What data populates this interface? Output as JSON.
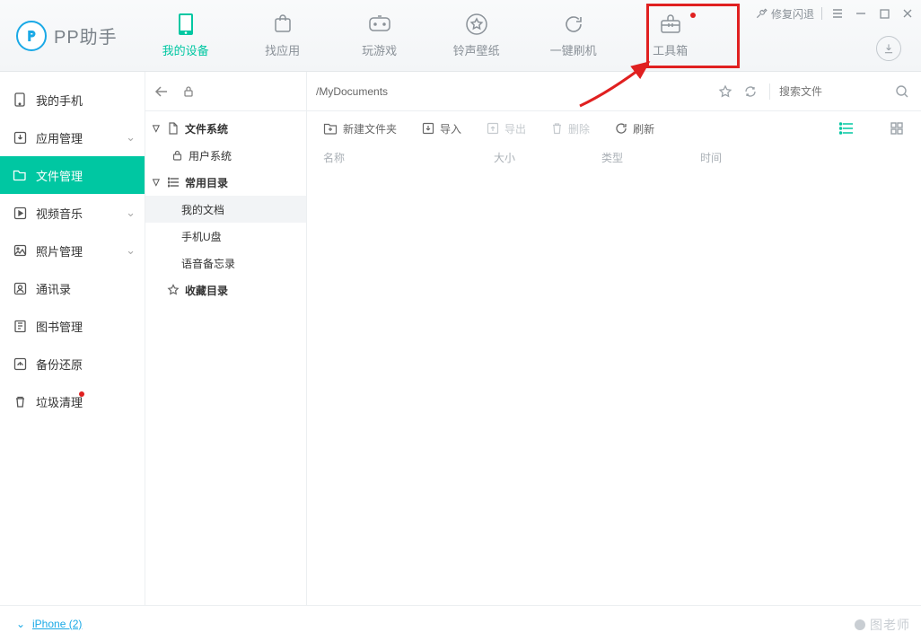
{
  "app": {
    "name": "PP助手"
  },
  "topnav": {
    "items": [
      {
        "label": "我的设备"
      },
      {
        "label": "找应用"
      },
      {
        "label": "玩游戏"
      },
      {
        "label": "铃声壁纸"
      },
      {
        "label": "一键刷机"
      },
      {
        "label": "工具箱"
      }
    ]
  },
  "topright": {
    "repair": "修复闪退"
  },
  "sidebar": {
    "items": [
      {
        "label": "我的手机"
      },
      {
        "label": "应用管理"
      },
      {
        "label": "文件管理"
      },
      {
        "label": "视频音乐"
      },
      {
        "label": "照片管理"
      },
      {
        "label": "通讯录"
      },
      {
        "label": "图书管理"
      },
      {
        "label": "备份还原"
      },
      {
        "label": "垃圾清理"
      }
    ]
  },
  "path": {
    "text": "/MyDocuments"
  },
  "tree": {
    "filesystem": "文件系统",
    "user_system": "用户系统",
    "common": "常用目录",
    "mydocs": "我的文档",
    "udisk": "手机U盘",
    "voice": "语音备忘录",
    "fav": "收藏目录"
  },
  "toolbar": {
    "new_folder": "新建文件夹",
    "import": "导入",
    "export": "导出",
    "delete": "删除",
    "refresh": "刷新"
  },
  "list_headers": {
    "name": "名称",
    "size": "大小",
    "type": "类型",
    "time": "时间"
  },
  "search": {
    "placeholder": "搜索文件"
  },
  "status": {
    "device": "iPhone (2)"
  },
  "watermark": "图老师"
}
